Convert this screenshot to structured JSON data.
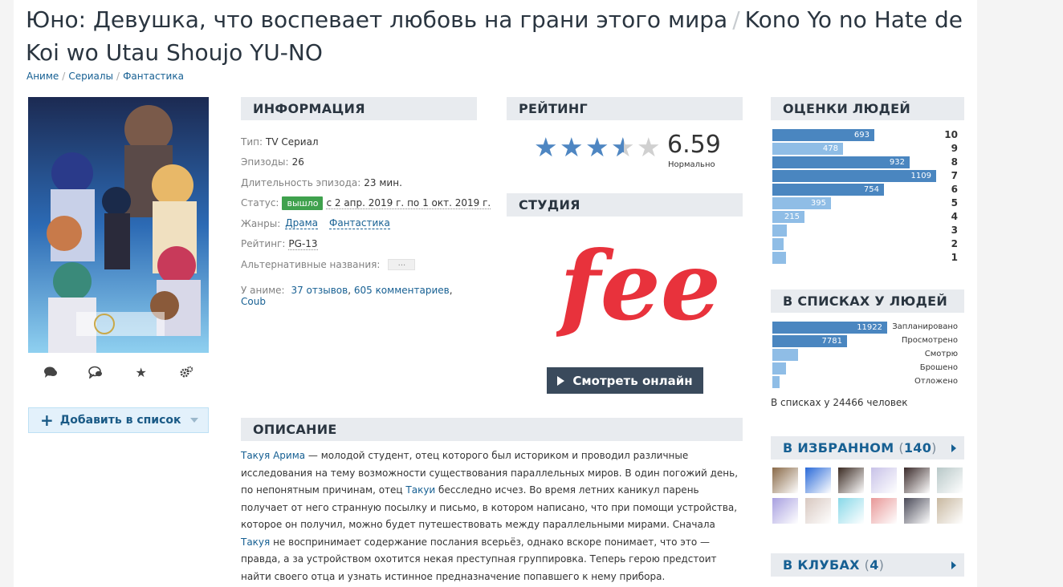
{
  "title": {
    "russian": "Юно: Девушка, что воспевает любовь на грани этого мира",
    "separator": "/",
    "romaji": "Kono Yo no Hate de Koi wo Utau Shoujo YU-NO"
  },
  "breadcrumbs": [
    "Аниме",
    "Сериалы",
    "Фантастика"
  ],
  "poster_actions": [
    "comments-icon",
    "reviews-icon",
    "favourite-star-icon",
    "settings-gears-icon"
  ],
  "add_to_list": "Добавить в список",
  "info": {
    "heading": "ИНФОРМАЦИЯ",
    "type_key": "Тип:",
    "type_val": "TV Сериал",
    "episodes_key": "Эпизоды:",
    "episodes_val": "26",
    "duration_key": "Длительность эпизода:",
    "duration_val": "23 мин.",
    "status_key": "Статус:",
    "status_badge": "вышло",
    "status_val": "с 2 апр. 2019 г. по 1 окт. 2019 г.",
    "genres_key": "Жанры:",
    "genres": [
      "Драма",
      "Фантастика"
    ],
    "rating_key": "Рейтинг:",
    "rating_val": "PG-13",
    "alt_key": "Альтернативные названия:",
    "alt_more": "...",
    "in_anime_key": "У аниме:",
    "links": [
      "37 отзывов",
      "605 комментариев",
      "Coub"
    ]
  },
  "rating": {
    "heading": "РЕЙТИНГ",
    "score": "6.59",
    "label": "Нормально",
    "stars_filled": 3.5,
    "stars_total": 5
  },
  "studio": {
    "heading": "СТУДИЯ",
    "logo_text": "feel",
    "logo_color": "#e8323c",
    "watch_label": "Смотреть онлайн"
  },
  "description": {
    "heading": "ОПИСАНИЕ",
    "parts": [
      {
        "text": "Такуя Арима",
        "link": true
      },
      {
        "text": " — молодой студент, отец которого был историком и проводил различные исследования на тему возможности существования параллельных миров. В один погожий день, по непонятным причинам, отец ",
        "link": false
      },
      {
        "text": "Такуи",
        "link": true
      },
      {
        "text": " бесследно исчез. Во время летних каникул парень получает от него странную посылку и письмо, в котором написано, что при помощи устройства, которое он получил, можно будет путешествовать между параллельными мирами. Сначала ",
        "link": false
      },
      {
        "text": "Такуя",
        "link": true
      },
      {
        "text": " не воспринимает содержание послания всерьёз, однако вскоре понимает, что это — правда, а за устройством охотится некая преступная группировка. Теперь герою предстоит найти своего отца и узнать истинное предназначение попавшего к нему прибора.",
        "link": false
      }
    ]
  },
  "people_scores": {
    "heading": "ОЦЕНКИ ЛЮДЕЙ",
    "max": 1109,
    "rows": [
      {
        "score": "10",
        "count": 693,
        "label": "693"
      },
      {
        "score": "9",
        "count": 478,
        "label": "478"
      },
      {
        "score": "8",
        "count": 932,
        "label": "932"
      },
      {
        "score": "7",
        "count": 1109,
        "label": "1109"
      },
      {
        "score": "6",
        "count": 754,
        "label": "754"
      },
      {
        "score": "5",
        "count": 395,
        "label": "395"
      },
      {
        "score": "4",
        "count": 215,
        "label": "215"
      },
      {
        "score": "3",
        "count": 100,
        "label": ""
      },
      {
        "score": "2",
        "count": 65,
        "label": ""
      },
      {
        "score": "1",
        "count": 95,
        "label": ""
      }
    ],
    "colors": {
      "dark": "#4a86c0",
      "light": "#8fbde6"
    }
  },
  "people_lists": {
    "heading": "В СПИСКАХ У ЛЮДЕЙ",
    "max": 11922,
    "rows": [
      {
        "status": "Запланировано",
        "count": 11922,
        "label": "11922"
      },
      {
        "status": "Просмотрено",
        "count": 7781,
        "label": "7781"
      },
      {
        "status": "Смотрю",
        "count": 2700,
        "label": ""
      },
      {
        "status": "Брошено",
        "count": 1450,
        "label": ""
      },
      {
        "status": "Отложено",
        "count": 750,
        "label": ""
      }
    ],
    "total_prefix": "В списках у",
    "total_count": "24466",
    "total_suffix": "человек"
  },
  "favourites": {
    "heading": "В ИЗБРАННОМ",
    "count": "140",
    "avatar_colors": [
      "#8a6a48",
      "#2a6ad8",
      "#3a2a22",
      "#c8c2e8",
      "#3a2a2a",
      "#b8c8c8",
      "#a8a0e0",
      "#d8c8c0",
      "#88d8e8",
      "#e89898",
      "#4a4a58",
      "#c8b8a0"
    ]
  },
  "clubs": {
    "heading": "В КЛУБАХ",
    "count": "4"
  }
}
